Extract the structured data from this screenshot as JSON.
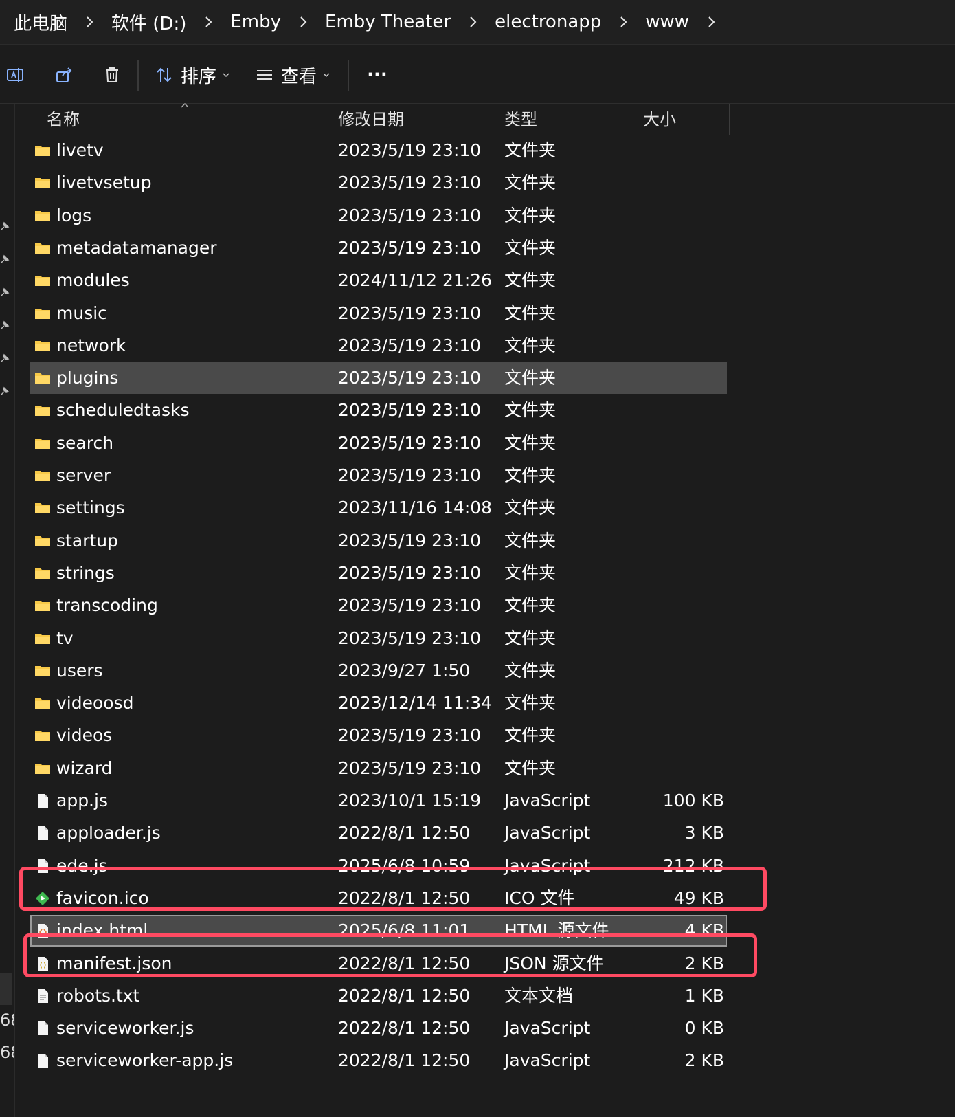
{
  "breadcrumb": [
    "此电脑",
    "软件 (D:)",
    "Emby",
    "Emby Theater",
    "electronapp",
    "www"
  ],
  "toolbar": {
    "sort_label": "排序",
    "view_label": "查看",
    "more_label": "···"
  },
  "columns": {
    "name": "名称",
    "date": "修改日期",
    "type": "类型",
    "size": "大小"
  },
  "left_strip_numbers": [
    "68",
    "68"
  ],
  "files": [
    {
      "name": "livetv",
      "date": "2023/5/19 23:10",
      "type": "文件夹",
      "size": "",
      "icon": "folder"
    },
    {
      "name": "livetvsetup",
      "date": "2023/5/19 23:10",
      "type": "文件夹",
      "size": "",
      "icon": "folder"
    },
    {
      "name": "logs",
      "date": "2023/5/19 23:10",
      "type": "文件夹",
      "size": "",
      "icon": "folder"
    },
    {
      "name": "metadatamanager",
      "date": "2023/5/19 23:10",
      "type": "文件夹",
      "size": "",
      "icon": "folder"
    },
    {
      "name": "modules",
      "date": "2024/11/12 21:26",
      "type": "文件夹",
      "size": "",
      "icon": "folder"
    },
    {
      "name": "music",
      "date": "2023/5/19 23:10",
      "type": "文件夹",
      "size": "",
      "icon": "folder"
    },
    {
      "name": "network",
      "date": "2023/5/19 23:10",
      "type": "文件夹",
      "size": "",
      "icon": "folder"
    },
    {
      "name": "plugins",
      "date": "2023/5/19 23:10",
      "type": "文件夹",
      "size": "",
      "icon": "folder",
      "selected": true
    },
    {
      "name": "scheduledtasks",
      "date": "2023/5/19 23:10",
      "type": "文件夹",
      "size": "",
      "icon": "folder"
    },
    {
      "name": "search",
      "date": "2023/5/19 23:10",
      "type": "文件夹",
      "size": "",
      "icon": "folder"
    },
    {
      "name": "server",
      "date": "2023/5/19 23:10",
      "type": "文件夹",
      "size": "",
      "icon": "folder"
    },
    {
      "name": "settings",
      "date": "2023/11/16 14:08",
      "type": "文件夹",
      "size": "",
      "icon": "folder"
    },
    {
      "name": "startup",
      "date": "2023/5/19 23:10",
      "type": "文件夹",
      "size": "",
      "icon": "folder"
    },
    {
      "name": "strings",
      "date": "2023/5/19 23:10",
      "type": "文件夹",
      "size": "",
      "icon": "folder"
    },
    {
      "name": "transcoding",
      "date": "2023/5/19 23:10",
      "type": "文件夹",
      "size": "",
      "icon": "folder"
    },
    {
      "name": "tv",
      "date": "2023/5/19 23:10",
      "type": "文件夹",
      "size": "",
      "icon": "folder"
    },
    {
      "name": "users",
      "date": "2023/9/27 1:50",
      "type": "文件夹",
      "size": "",
      "icon": "folder"
    },
    {
      "name": "videoosd",
      "date": "2023/12/14 11:34",
      "type": "文件夹",
      "size": "",
      "icon": "folder"
    },
    {
      "name": "videos",
      "date": "2023/5/19 23:10",
      "type": "文件夹",
      "size": "",
      "icon": "folder"
    },
    {
      "name": "wizard",
      "date": "2023/5/19 23:10",
      "type": "文件夹",
      "size": "",
      "icon": "folder"
    },
    {
      "name": "app.js",
      "date": "2023/10/1 15:19",
      "type": "JavaScript",
      "size": "100 KB",
      "icon": "file"
    },
    {
      "name": "apploader.js",
      "date": "2022/8/1 12:50",
      "type": "JavaScript",
      "size": "3 KB",
      "icon": "file"
    },
    {
      "name": "ede.js",
      "date": "2025/6/8 10:59",
      "type": "JavaScript",
      "size": "212 KB",
      "icon": "file",
      "highlighted": true
    },
    {
      "name": "favicon.ico",
      "date": "2022/8/1 12:50",
      "type": "ICO 文件",
      "size": "49 KB",
      "icon": "ico"
    },
    {
      "name": "index.html",
      "date": "2025/6/8 11:01",
      "type": "HTML 源文件",
      "size": "4 KB",
      "icon": "html",
      "selected": true,
      "focused": true,
      "highlighted": true
    },
    {
      "name": "manifest.json",
      "date": "2022/8/1 12:50",
      "type": "JSON 源文件",
      "size": "2 KB",
      "icon": "json"
    },
    {
      "name": "robots.txt",
      "date": "2022/8/1 12:50",
      "type": "文本文档",
      "size": "1 KB",
      "icon": "txt"
    },
    {
      "name": "serviceworker.js",
      "date": "2022/8/1 12:50",
      "type": "JavaScript",
      "size": "0 KB",
      "icon": "file"
    },
    {
      "name": "serviceworker-app.js",
      "date": "2022/8/1 12:50",
      "type": "JavaScript",
      "size": "2 KB",
      "icon": "file"
    }
  ],
  "colors": {
    "background": "#1c1c1c",
    "folder": "#f7c948",
    "selection": "#4a4a4a",
    "highlight_box": "#ff4a62"
  }
}
